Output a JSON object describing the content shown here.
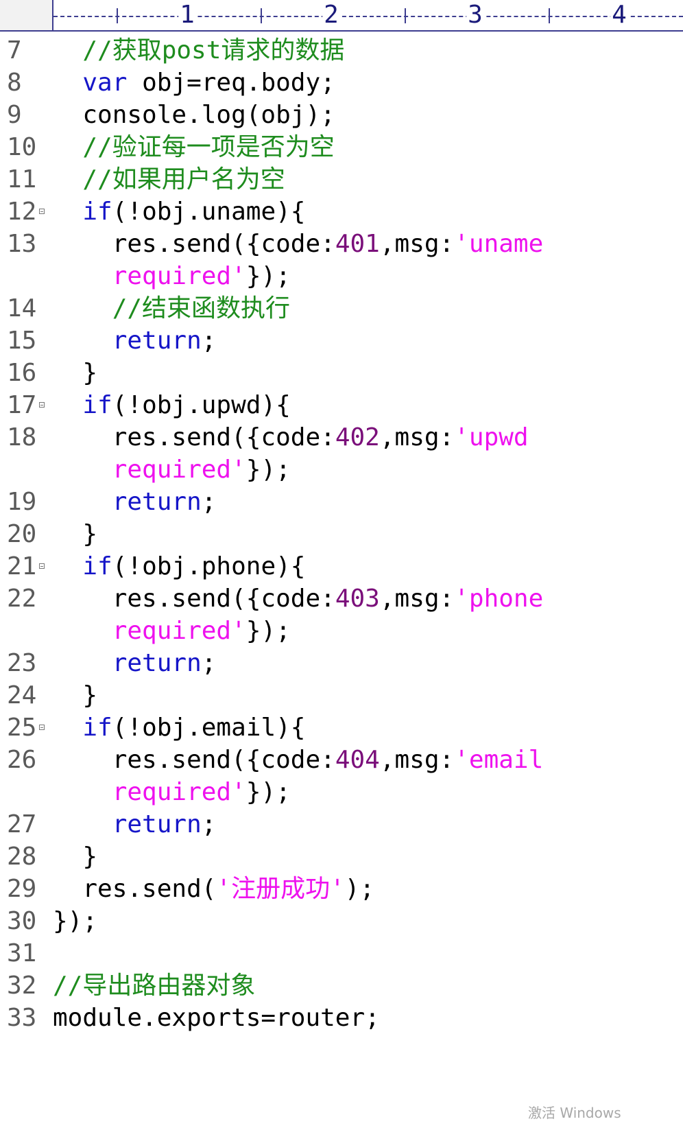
{
  "ruler": {
    "labels": [
      "1",
      "2",
      "3",
      "4"
    ]
  },
  "lines": [
    {
      "n": "7",
      "fold": false,
      "tokens": [
        {
          "t": "  "
        },
        {
          "t": "//获取post请求的数据",
          "c": "cm"
        }
      ]
    },
    {
      "n": "8",
      "fold": false,
      "tokens": [
        {
          "t": "  "
        },
        {
          "t": "var",
          "c": "kw"
        },
        {
          "t": " obj=req.body;"
        }
      ]
    },
    {
      "n": "9",
      "fold": false,
      "tokens": [
        {
          "t": "  console.log(obj);"
        }
      ]
    },
    {
      "n": "10",
      "fold": false,
      "tokens": [
        {
          "t": "  "
        },
        {
          "t": "//验证每一项是否为空",
          "c": "cm"
        }
      ]
    },
    {
      "n": "11",
      "fold": false,
      "tokens": [
        {
          "t": "  "
        },
        {
          "t": "//如果用户名为空",
          "c": "cm"
        }
      ]
    },
    {
      "n": "12",
      "fold": true,
      "tokens": [
        {
          "t": "  "
        },
        {
          "t": "if",
          "c": "kw"
        },
        {
          "t": "(!obj.uname){"
        }
      ]
    },
    {
      "n": "13",
      "fold": false,
      "tokens": [
        {
          "t": "    res.send({code:"
        },
        {
          "t": "401",
          "c": "num"
        },
        {
          "t": ",msg:"
        },
        {
          "t": "'uname",
          "c": "str"
        }
      ]
    },
    {
      "n": "",
      "fold": false,
      "tokens": [
        {
          "t": "    "
        },
        {
          "t": "required'",
          "c": "str"
        },
        {
          "t": "});"
        }
      ]
    },
    {
      "n": "14",
      "fold": false,
      "tokens": [
        {
          "t": "    "
        },
        {
          "t": "//结束函数执行",
          "c": "cm"
        }
      ]
    },
    {
      "n": "15",
      "fold": false,
      "tokens": [
        {
          "t": "    "
        },
        {
          "t": "return",
          "c": "kw"
        },
        {
          "t": ";"
        }
      ]
    },
    {
      "n": "16",
      "fold": false,
      "tokens": [
        {
          "t": "  }"
        }
      ]
    },
    {
      "n": "17",
      "fold": true,
      "tokens": [
        {
          "t": "  "
        },
        {
          "t": "if",
          "c": "kw"
        },
        {
          "t": "(!obj.upwd){"
        }
      ]
    },
    {
      "n": "18",
      "fold": false,
      "tokens": [
        {
          "t": "    res.send({code:"
        },
        {
          "t": "402",
          "c": "num"
        },
        {
          "t": ",msg:"
        },
        {
          "t": "'upwd",
          "c": "str"
        }
      ]
    },
    {
      "n": "",
      "fold": false,
      "tokens": [
        {
          "t": "    "
        },
        {
          "t": "required'",
          "c": "str"
        },
        {
          "t": "});"
        }
      ]
    },
    {
      "n": "19",
      "fold": false,
      "tokens": [
        {
          "t": "    "
        },
        {
          "t": "return",
          "c": "kw"
        },
        {
          "t": ";"
        }
      ]
    },
    {
      "n": "20",
      "fold": false,
      "tokens": [
        {
          "t": "  }"
        }
      ]
    },
    {
      "n": "21",
      "fold": true,
      "tokens": [
        {
          "t": "  "
        },
        {
          "t": "if",
          "c": "kw"
        },
        {
          "t": "(!obj.phone){"
        }
      ]
    },
    {
      "n": "22",
      "fold": false,
      "tokens": [
        {
          "t": "    res.send({code:"
        },
        {
          "t": "403",
          "c": "num"
        },
        {
          "t": ",msg:"
        },
        {
          "t": "'phone",
          "c": "str"
        }
      ]
    },
    {
      "n": "",
      "fold": false,
      "tokens": [
        {
          "t": "    "
        },
        {
          "t": "required'",
          "c": "str"
        },
        {
          "t": "});"
        }
      ]
    },
    {
      "n": "23",
      "fold": false,
      "tokens": [
        {
          "t": "    "
        },
        {
          "t": "return",
          "c": "kw"
        },
        {
          "t": ";"
        }
      ]
    },
    {
      "n": "24",
      "fold": false,
      "tokens": [
        {
          "t": "  }"
        }
      ]
    },
    {
      "n": "25",
      "fold": true,
      "tokens": [
        {
          "t": "  "
        },
        {
          "t": "if",
          "c": "kw"
        },
        {
          "t": "(!obj.email){"
        }
      ]
    },
    {
      "n": "26",
      "fold": false,
      "tokens": [
        {
          "t": "    res.send({code:"
        },
        {
          "t": "404",
          "c": "num"
        },
        {
          "t": ",msg:"
        },
        {
          "t": "'email",
          "c": "str"
        }
      ]
    },
    {
      "n": "",
      "fold": false,
      "tokens": [
        {
          "t": "    "
        },
        {
          "t": "required'",
          "c": "str"
        },
        {
          "t": "});"
        }
      ]
    },
    {
      "n": "27",
      "fold": false,
      "tokens": [
        {
          "t": "    "
        },
        {
          "t": "return",
          "c": "kw"
        },
        {
          "t": ";"
        }
      ]
    },
    {
      "n": "28",
      "fold": false,
      "tokens": [
        {
          "t": "  }"
        }
      ]
    },
    {
      "n": "29",
      "fold": false,
      "tokens": [
        {
          "t": "  res.send("
        },
        {
          "t": "'注册成功'",
          "c": "str"
        },
        {
          "t": ");"
        }
      ]
    },
    {
      "n": "30",
      "fold": false,
      "tokens": [
        {
          "t": "});"
        }
      ]
    },
    {
      "n": "31",
      "fold": false,
      "tokens": []
    },
    {
      "n": "32",
      "fold": false,
      "tokens": [
        {
          "t": "//导出路由器对象",
          "c": "cm"
        }
      ]
    },
    {
      "n": "33",
      "fold": false,
      "tokens": [
        {
          "t": "module.exports=router;"
        }
      ]
    }
  ],
  "watermark": "激活 Windows",
  "colors": {
    "comment": "#1e8c1e",
    "keyword": "#1515c8",
    "number": "#7a0f7a",
    "string": "#ee11ee",
    "line_number": "#5a5a5a",
    "ruler": "#3d3d8f"
  }
}
